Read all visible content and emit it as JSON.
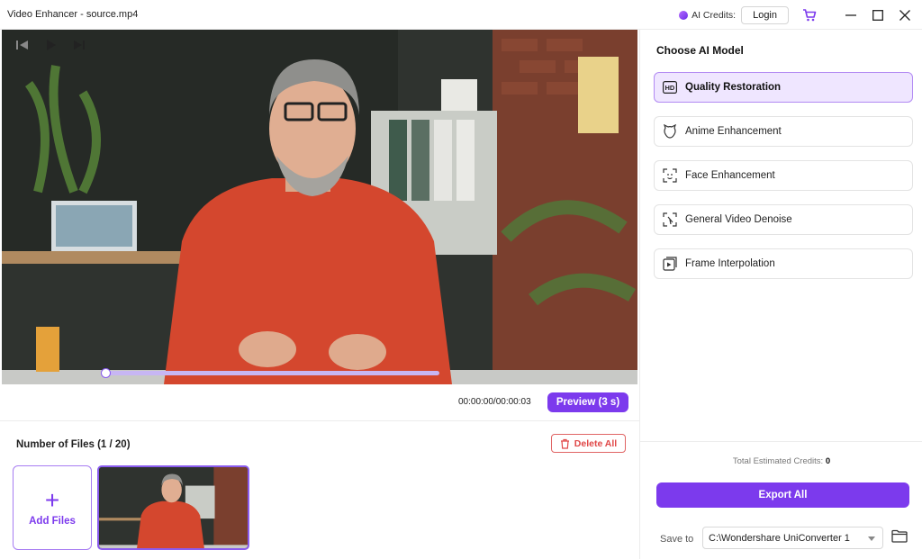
{
  "window": {
    "title": "Video Enhancer - source.mp4"
  },
  "titlebar": {
    "credits_label": "AI Credits:",
    "login_label": "Login"
  },
  "player": {
    "time": "00:00:00/00:00:03",
    "preview_label": "Preview (3 s)",
    "progress": 0.0
  },
  "files": {
    "title": "Number of Files (1 / 20)",
    "delete_all_label": "Delete All",
    "add_files_label": "Add Files"
  },
  "ai_model": {
    "title": "Choose AI Model",
    "models": [
      {
        "label": "Quality Restoration",
        "icon": "hd-icon",
        "selected": true
      },
      {
        "label": "Anime Enhancement",
        "icon": "anime-face-icon",
        "selected": false
      },
      {
        "label": "Face Enhancement",
        "icon": "face-scan-icon",
        "selected": false
      },
      {
        "label": "General Video Denoise",
        "icon": "denoise-icon",
        "selected": false
      },
      {
        "label": "Frame Interpolation",
        "icon": "frame-interpolation-icon",
        "selected": false
      }
    ]
  },
  "footer": {
    "est_credits_label": "Total Estimated Credits:",
    "est_credits_value": "0",
    "export_label": "Export All",
    "save_to_label": "Save to",
    "save_path": "C:\\Wondershare UniConverter 1"
  },
  "colors": {
    "accent": "#7c3aed",
    "accent_light": "#efe6ff",
    "danger": "#e04848"
  }
}
